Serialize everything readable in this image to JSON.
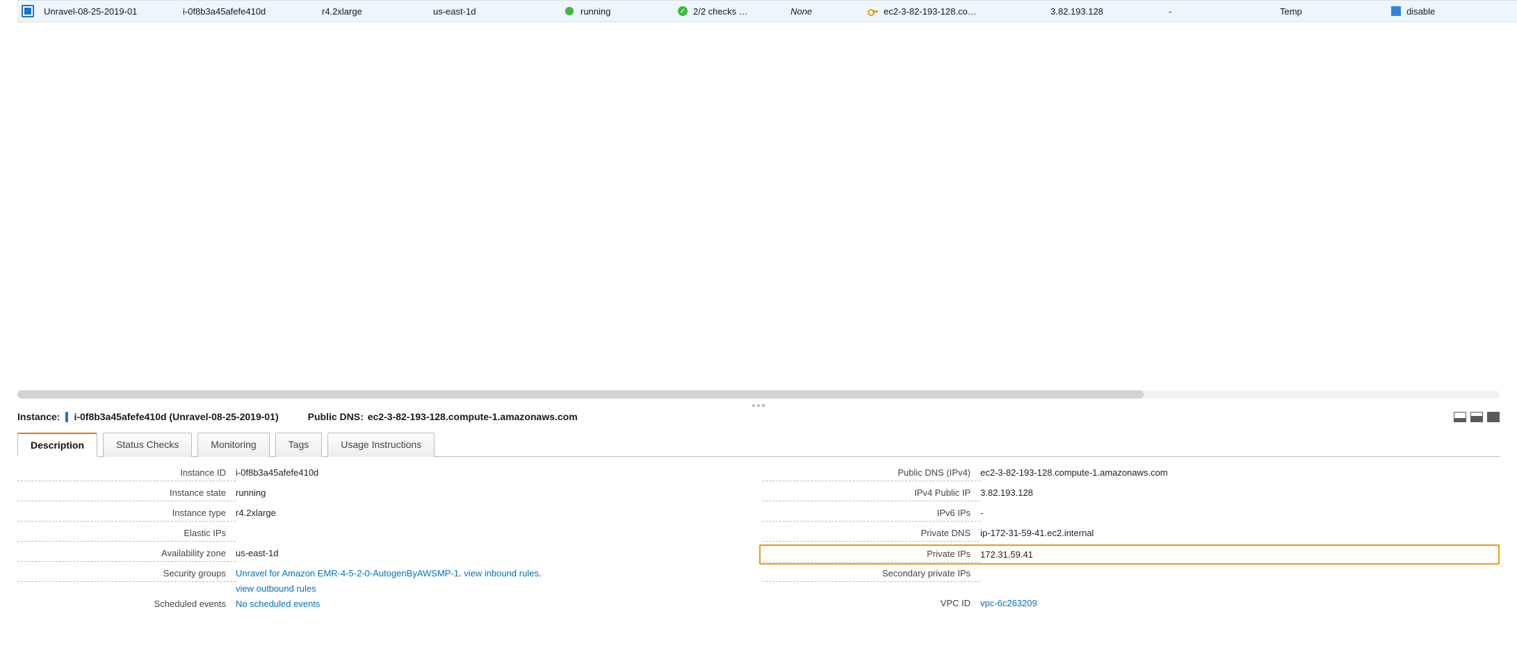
{
  "row": {
    "name": "Unravel-08-25-2019-01",
    "instance_id": "i-0f8b3a45afefe410d",
    "instance_type": "r4.2xlarge",
    "az": "us-east-1d",
    "state": "running",
    "status": "2/2 checks …",
    "alarm": "None",
    "public_dns_short": "ec2-3-82-193-128.co…",
    "public_ip": "3.82.193.128",
    "dash": "-",
    "tag": "Temp",
    "monitoring": "disable"
  },
  "details": {
    "header": {
      "instance_label": "Instance:",
      "instance_value": "i-0f8b3a45afefe410d (Unravel-08-25-2019-01)",
      "dns_label": "Public DNS:",
      "dns_value": "ec2-3-82-193-128.compute-1.amazonaws.com"
    },
    "tabs": {
      "description": "Description",
      "status_checks": "Status Checks",
      "monitoring": "Monitoring",
      "tags": "Tags",
      "usage": "Usage Instructions"
    },
    "left": {
      "instance_id_label": "Instance ID",
      "instance_id": "i-0f8b3a45afefe410d",
      "instance_state_label": "Instance state",
      "instance_state": "running",
      "instance_type_label": "Instance type",
      "instance_type": "r4.2xlarge",
      "elastic_ips_label": "Elastic IPs",
      "elastic_ips": "",
      "az_label": "Availability zone",
      "az": "us-east-1d",
      "sg_label": "Security groups",
      "sg_link": "Unravel for Amazon EMR-4-5-2-0-AutogenByAWSMP-1",
      "sg_dot": ". ",
      "sg_inbound": "view inbound rules",
      "sg_dot2": ". ",
      "sg_outbound": "view outbound rules",
      "sched_label": "Scheduled events",
      "sched_link": "No scheduled events"
    },
    "right": {
      "pub_dns_label": "Public DNS (IPv4)",
      "pub_dns": "ec2-3-82-193-128.compute-1.amazonaws.com",
      "pub_ip_label": "IPv4 Public IP",
      "pub_ip": "3.82.193.128",
      "ipv6_label": "IPv6 IPs",
      "ipv6": "-",
      "priv_dns_label": "Private DNS",
      "priv_dns": "ip-172-31-59-41.ec2.internal",
      "priv_ips_label": "Private IPs",
      "priv_ips": "172.31.59.41",
      "sec_priv_label": "Secondary private IPs",
      "sec_priv": "",
      "vpc_label": "VPC ID",
      "vpc_link": "vpc-6c263209"
    }
  }
}
